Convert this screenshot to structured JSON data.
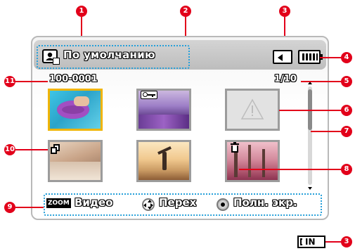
{
  "header": {
    "mode_label": "По умолчанию"
  },
  "grid": {
    "folder_file": "100-0001",
    "page_counter": "1/10"
  },
  "footer": {
    "zoom_tag": "ZOOM",
    "video_label": "Видео",
    "move_label": "Перех",
    "fullscreen_label": "Полн. экр."
  },
  "callouts": [
    "1",
    "2",
    "3",
    "4",
    "5",
    "6",
    "7",
    "8",
    "9",
    "10",
    "11",
    "3"
  ],
  "badge": {
    "in_label": "IN"
  },
  "colors": {
    "callout_red": "#e2001a",
    "dotted_blue": "#26a0da",
    "selected_border": "#f0b400"
  }
}
